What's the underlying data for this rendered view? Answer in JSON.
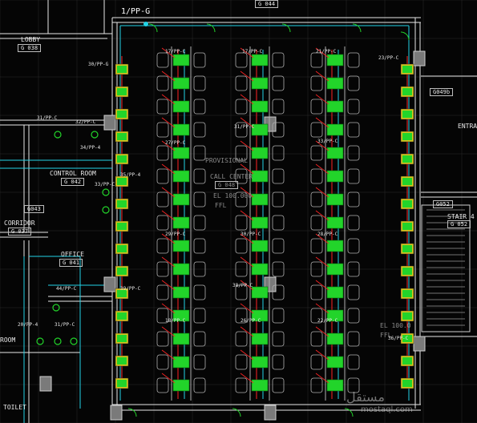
{
  "drawing": {
    "panel_tag": "1/PP-G",
    "rooms": {
      "lobby": {
        "name": "LOBBY",
        "code": "G 038"
      },
      "control_room": {
        "name": "CONTROL ROOM",
        "code": "G 042"
      },
      "corridor": {
        "name": "CORRIDOR",
        "code": "G 037"
      },
      "office": {
        "name": "OFFICE",
        "code": "G 041"
      },
      "call_center": {
        "name_line1": "PROVISIONAL",
        "name_line2": "CALL CENTER",
        "code": "G 048"
      },
      "stair": {
        "name": "STAIR 4",
        "code": "G 052"
      },
      "entrance": {
        "name": "ENTRA"
      },
      "toilet": {
        "name": "TOILET"
      },
      "room_left": {
        "name": "ROOM"
      },
      "top_ref": {
        "code": "G 044"
      }
    },
    "tags": {
      "g043": "G043",
      "g049b": "G049b",
      "g052": "G052",
      "g038": "G038",
      "g042": "G042",
      "g044": "G044"
    },
    "levels": {
      "center_line1": "EL 100.000",
      "center_line2": "FFL",
      "right_line1": "EL 100.0",
      "right_line2": "FFL"
    },
    "circuit_labels": [
      "31/PP-C",
      "32/PP-C",
      "34/PP-4",
      "35/PP-4",
      "33/PP-C",
      "44/PP-C",
      "20/PP-4",
      "31/PP-C",
      "39/PP-C",
      "30/PP-G",
      "17/PP-C",
      "17/PP-C",
      "21/PP-C",
      "27/PP-C",
      "31/PP-C",
      "33/PP-C",
      "29/PP-C",
      "30/PP-C",
      "28/PP-C",
      "38/PP-C",
      "18/PP-C",
      "26/PP-C",
      "22/PP-C",
      "23/PP-C",
      "36/PP-C"
    ],
    "colors": {
      "background": "#050505",
      "wall": "#e6e6e6",
      "desk_block": "#22d42a",
      "desk_outline": "#b0b0b0",
      "circuit_red": "#ff2424",
      "circuit_cyan": "#22d3e6",
      "grid": "#2a2a2a"
    }
  },
  "watermark": {
    "arabic": "مستقل",
    "latin": "mostaql.com"
  }
}
